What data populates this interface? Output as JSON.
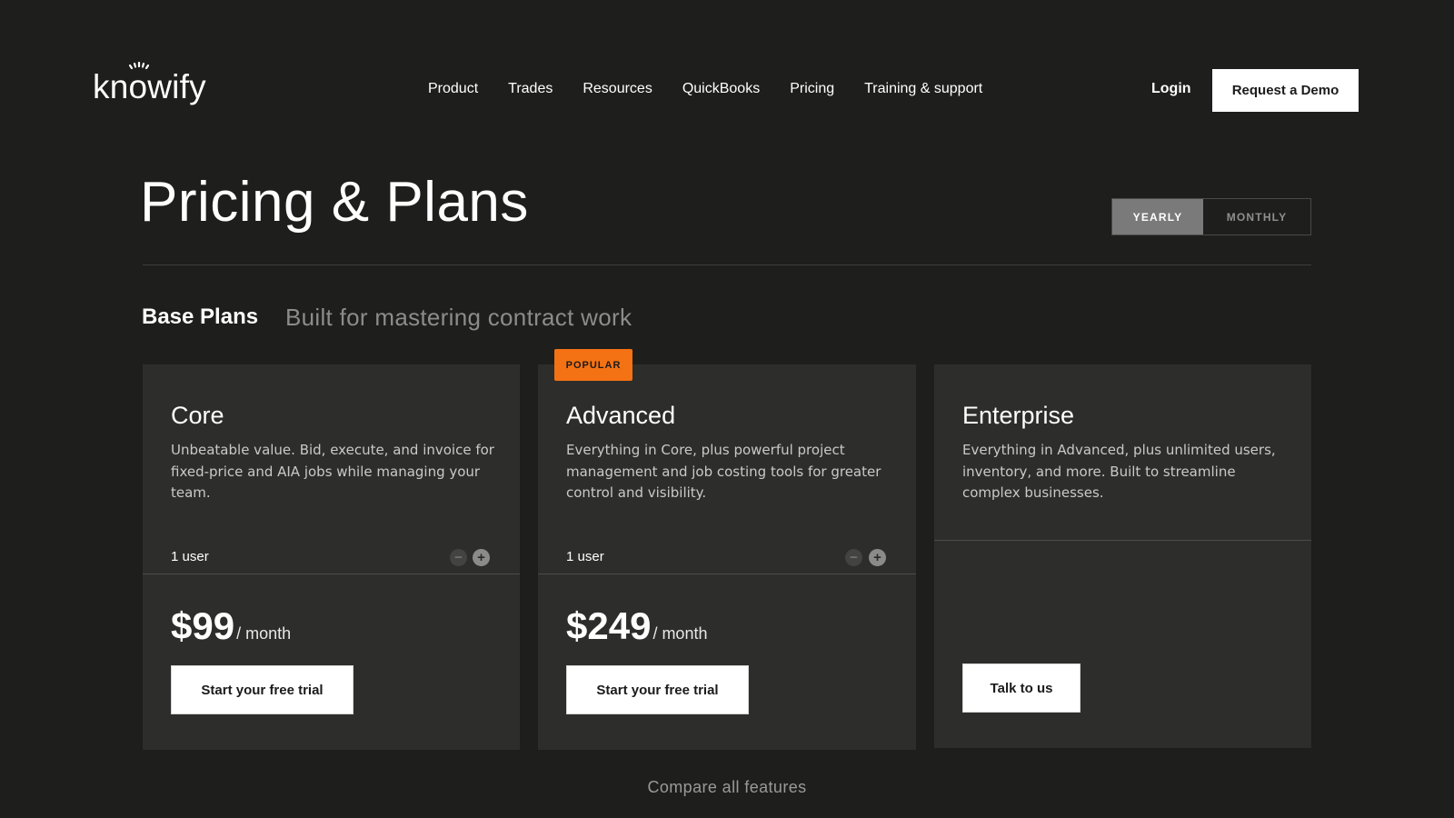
{
  "header": {
    "logo_prefix": "kn",
    "logo_o": "o",
    "logo_suffix": "wify",
    "nav": [
      "Product",
      "Trades",
      "Resources",
      "QuickBooks",
      "Pricing",
      "Training & support"
    ],
    "login_label": "Login",
    "demo_label": "Request a Demo"
  },
  "hero": {
    "title": "Pricing & Plans",
    "billing_toggle": {
      "yearly": "YEARLY",
      "monthly": "MONTHLY",
      "selected": "YEARLY"
    }
  },
  "section": {
    "title": "Base Plans",
    "subtitle": "Built for mastering contract work"
  },
  "plans": [
    {
      "name": "Core",
      "description": "Unbeatable value. Bid, execute, and invoice for fixed-price and AIA jobs while managing your team.",
      "users": "1 user",
      "price": "$99",
      "price_unit": "/ month",
      "cta": "Start your free trial"
    },
    {
      "name": "Advanced",
      "badge": "POPULAR",
      "description": "Everything in Core, plus powerful project management and job costing tools for greater control and visibility.",
      "users": "1 user",
      "price": "$249",
      "price_unit": "/ month",
      "cta": "Start your free trial"
    },
    {
      "name": "Enterprise",
      "description": "Everything in Advanced, plus unlimited users, inventory, and more. Built to streamline complex businesses.",
      "cta": "Talk to us"
    }
  ],
  "stepper": {
    "minus": "−",
    "plus": "+"
  },
  "footer_link": "Compare all features",
  "colors": {
    "background": "#1e1e1c",
    "card": "#2d2d2c",
    "badge": "#f47214",
    "toggle_selected": "#7a7a7a"
  },
  "icons": [
    "logo-sunrise-icon",
    "minus-icon",
    "plus-icon"
  ]
}
